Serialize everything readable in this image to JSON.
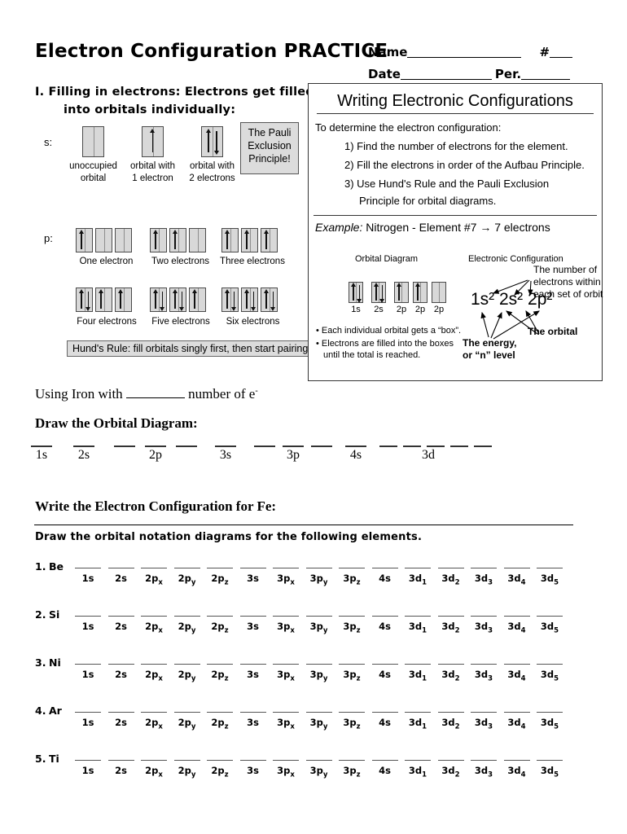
{
  "header": {
    "title": "Electron Configuration PRACTICE",
    "name_label": "Name",
    "number_label": "#",
    "date_label": "Date",
    "period_label": "Per."
  },
  "section_one": {
    "heading_line1": "I. Filling in electrons: Electrons get filled",
    "heading_line2": "into orbitals individually:",
    "s_label": "s:",
    "p_label": "p:",
    "s_examples": [
      {
        "caption_line1": "unoccupied",
        "caption_line2": "orbital",
        "electrons": 0
      },
      {
        "caption_line1": "orbital with",
        "caption_line2": "1 electron",
        "electrons": 1
      },
      {
        "caption_line1": "orbital with",
        "caption_line2": "2 electrons",
        "electrons": 2
      }
    ],
    "pauli_box": {
      "line1": "The Pauli",
      "line2": "Exclusion",
      "line3": "Principle!"
    },
    "p_examples": [
      {
        "caption": "One electron",
        "boxes": [
          1,
          0,
          0
        ]
      },
      {
        "caption": "Two electrons",
        "boxes": [
          1,
          1,
          0
        ]
      },
      {
        "caption": "Three electrons",
        "boxes": [
          1,
          1,
          1
        ]
      },
      {
        "caption": "Four electrons",
        "boxes": [
          2,
          1,
          1
        ]
      },
      {
        "caption": "Five electrons",
        "boxes": [
          2,
          2,
          1
        ]
      },
      {
        "caption": "Six electrons",
        "boxes": [
          2,
          2,
          2
        ]
      }
    ],
    "hunds_rule": "Hund's Rule: fill orbitals singly first, then start pairing!"
  },
  "writing_box": {
    "title": "Writing Electronic Configurations",
    "intro": "To determine the electron configuration:",
    "steps": [
      "1) Find the number of electrons for the element.",
      "2) Fill the electrons in order of the Aufbau Principle.",
      "3) Use Hund's Rule and the Pauli Exclusion",
      "Principle for orbital diagrams."
    ],
    "example_prefix": "Example:",
    "example_text": "Nitrogen - Element #7 → 7 electrons",
    "orbital_diagram_label": "Orbital Diagram",
    "electronic_config_label": "Electronic Configuration",
    "nitrogen_boxes": [
      {
        "label": "1s",
        "electrons": 2
      },
      {
        "label": "2s",
        "electrons": 2
      },
      {
        "label": "2p",
        "electrons": 1
      },
      {
        "label": "2p",
        "electrons": 1
      },
      {
        "label": "2p",
        "electrons": 0
      }
    ],
    "bullets": [
      "• Each individual orbital gets a “box”.",
      "• Electrons are filled into the boxes",
      "until the total is reached."
    ],
    "configuration": "1s² 2s² 2p²",
    "annotations": {
      "number_of_electrons_l1": "The number of",
      "number_of_electrons_l2": "electrons within",
      "number_of_electrons_l3": "each set of orbit",
      "the_orbital": "The orbital",
      "energy_l1": "The energy,",
      "energy_l2": "or “n” level"
    }
  },
  "iron_section": {
    "using_iron_pre": "Using Iron with",
    "using_iron_post": "number of  e",
    "superscript": "-",
    "draw_orbital_heading": "Draw the Orbital Diagram:",
    "orbital_groups": [
      {
        "label": "1s",
        "count": 1
      },
      {
        "label": "2s",
        "count": 1
      },
      {
        "label": "2p",
        "count": 3
      },
      {
        "label": "3s",
        "count": 1
      },
      {
        "label": "3p",
        "count": 3
      },
      {
        "label": "4s",
        "count": 1
      },
      {
        "label": "3d",
        "count": 5
      }
    ],
    "write_config_heading": "Write the Electron Configuration for Fe:"
  },
  "practice": {
    "instruction": "Draw the orbital notation diagrams for the following elements.",
    "orbital_labels": [
      "1s",
      "2s",
      "2p<sub>x</sub>",
      "2p<sub>y</sub>",
      "2p<sub>z</sub>",
      "3s",
      "3p<sub>x</sub>",
      "3p<sub>y</sub>",
      "3p<sub>z</sub>",
      "4s",
      "3d<sub>1</sub>",
      "3d<sub>2</sub>",
      "3d<sub>3</sub>",
      "3d<sub>4</sub>",
      "3d<sub>5</sub>"
    ],
    "items": [
      {
        "number": "1.",
        "element": "Be"
      },
      {
        "number": "2.",
        "element": "Si"
      },
      {
        "number": "3.",
        "element": "Ni"
      },
      {
        "number": "4.",
        "element": "Ar"
      },
      {
        "number": "5.",
        "element": "Ti"
      }
    ]
  }
}
